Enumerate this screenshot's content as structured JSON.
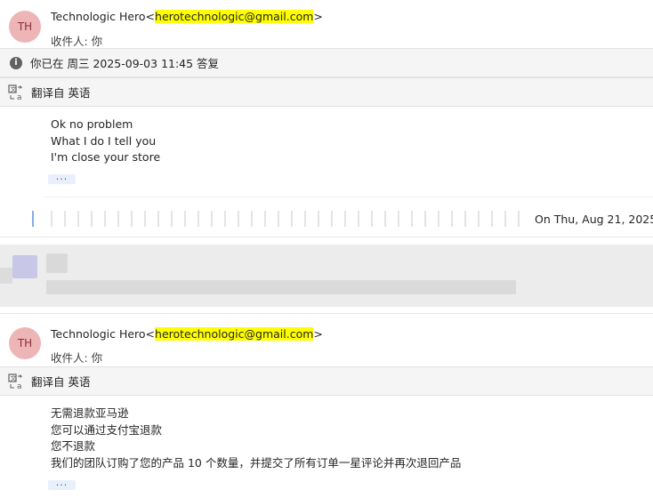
{
  "msg1": {
    "avatar_initials": "TH",
    "sender_name": "Technologic Hero",
    "lt": "<",
    "sender_email": "herotechnologic@gmail.com",
    "gt": ">",
    "recipient": "收件人: 你",
    "replied_info": "你已在 周三 2025-09-03 11:45 答复",
    "translated_from": "翻译自 英语",
    "body": [
      "Ok no problem",
      "What I do I tell you",
      "I'm close your store"
    ],
    "more_label": "...",
    "quoted_preview": "On Thu, Aug 21, 2025,"
  },
  "msg2": {
    "avatar_initials": "TH",
    "sender_name": "Technologic Hero",
    "lt": "<",
    "sender_email": "herotechnologic@gmail.com",
    "gt": ">",
    "recipient": "收件人: 你",
    "translated_from": "翻译自 英语",
    "body": [
      "无需退款亚马逊",
      "您可以通过支付宝退款",
      "您不退款",
      "我们的团队订购了您的产品 10 个数量，并提交了所有订单一星评论并再次退回产品"
    ],
    "more_label": "..."
  },
  "icons": {
    "info": "info-icon",
    "translate": "translate-icon",
    "avatar": "avatar"
  },
  "colors": {
    "highlight": "#ffff00",
    "avatar_bg": "#eeb5b7",
    "avatar_text": "#8a2f36",
    "bar_bg": "#f5f5f5",
    "accent": "#0f6cbd"
  }
}
